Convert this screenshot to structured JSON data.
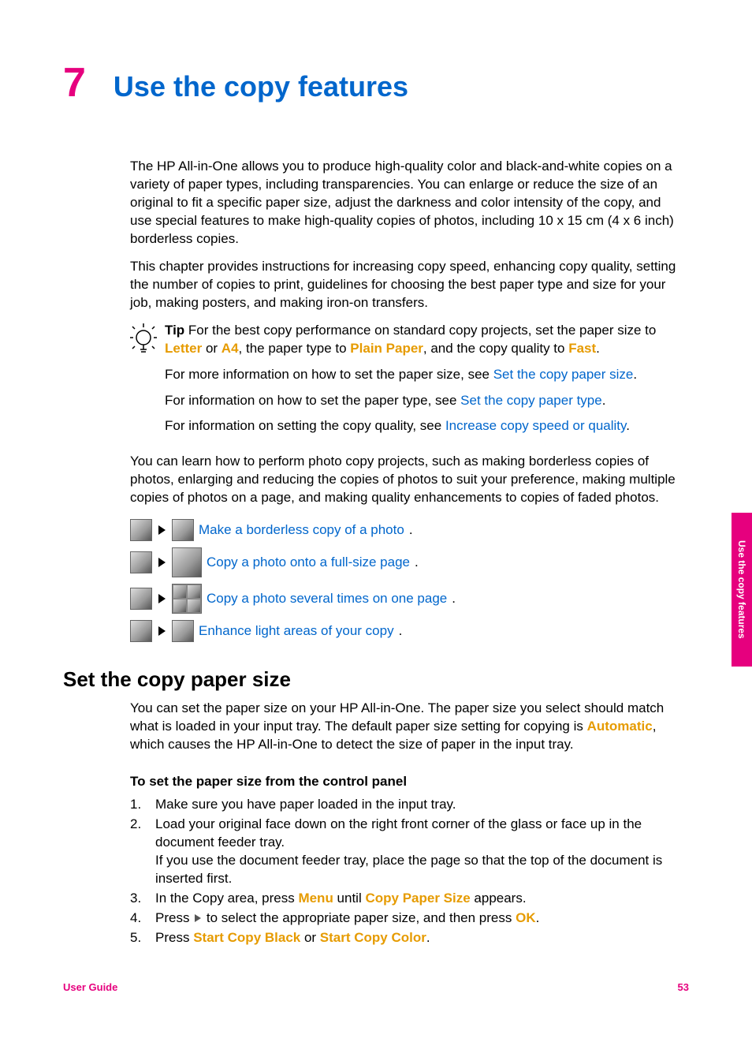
{
  "chapter": {
    "number": "7",
    "title": "Use the copy features"
  },
  "intro": {
    "p1": "The HP All-in-One allows you to produce high-quality color and black-and-white copies on a variety of paper types, including transparencies. You can enlarge or reduce the size of an original to fit a specific paper size, adjust the darkness and color intensity of the copy, and use special features to make high-quality copies of photos, including 10 x 15 cm (4 x 6 inch) borderless copies.",
    "p2": "This chapter provides instructions for increasing copy speed, enhancing copy quality, setting the number of copies to print, guidelines for choosing the best paper type and size for your job, making posters, and making iron-on transfers."
  },
  "tip": {
    "label": "Tip",
    "line1_a": " For the best copy performance on standard copy projects, set the paper size to ",
    "letter": "Letter",
    "or": " or ",
    "a4": "A4",
    "line1_b": ", the paper type to ",
    "plain": "Plain Paper",
    "line1_c": ", and the copy quality to ",
    "fast": "Fast",
    "period": ".",
    "line2_a": "For more information on how to set the paper size, see ",
    "link2": "Set the copy paper size",
    "line3_a": "For information on how to set the paper type, see ",
    "link3": "Set the copy paper type",
    "line4_a": "For information on setting the copy quality, see ",
    "link4": "Increase copy speed or quality"
  },
  "photo_intro": "You can learn how to perform photo copy projects, such as making borderless copies of photos, enlarging and reducing the copies of photos to suit your preference, making multiple copies of photos on a page, and making quality enhancements to copies of faded photos.",
  "photo_links": {
    "l1": "Make a borderless copy of a photo",
    "l2": "Copy a photo onto a full-size page",
    "l3": "Copy a photo several times on one page",
    "l4": "Enhance light areas of your copy"
  },
  "section": {
    "heading": "Set the copy paper size",
    "p_a": "You can set the paper size on your HP All-in-One. The paper size you select should match what is loaded in your input tray. The default paper size setting for copying is ",
    "auto": "Automatic",
    "p_b": ", which causes the HP All-in-One to detect the size of paper in the input tray.",
    "subheading": "To set the paper size from the control panel",
    "steps": {
      "s1": "Make sure you have paper loaded in the input tray.",
      "s2a": "Load your original face down on the right front corner of the glass or face up in the document feeder tray.",
      "s2b": "If you use the document feeder tray, place the page so that the top of the document is inserted first.",
      "s3a": "In the Copy area, press ",
      "s3_menu": "Menu",
      "s3b": " until ",
      "s3_cps": "Copy Paper Size",
      "s3c": " appears.",
      "s4a": "Press ",
      "s4b": " to select the appropriate paper size, and then press ",
      "s4_ok": "OK",
      "s5a": "Press ",
      "s5_black": "Start Copy Black",
      "s5_or": " or ",
      "s5_color": "Start Copy Color"
    }
  },
  "sidetab": "Use the copy features",
  "footer": {
    "left": "User Guide",
    "right": "53"
  }
}
